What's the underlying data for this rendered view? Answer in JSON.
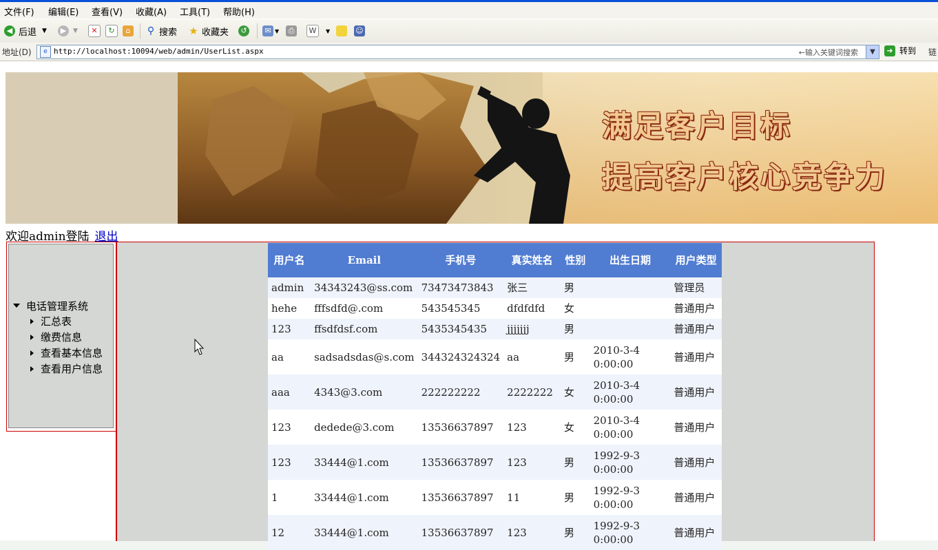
{
  "browser": {
    "menu": [
      "文件(F)",
      "编辑(E)",
      "查看(V)",
      "收藏(A)",
      "工具(T)",
      "帮助(H)"
    ],
    "toolbar": {
      "back_label": "后退",
      "search_label": "搜索",
      "favorites_label": "收藏夹"
    },
    "address_label": "地址(D)",
    "url": "http://localhost:10094/web/admin/UserList.aspx",
    "search_placeholder": "←输入关键词搜索",
    "go_label": "转到",
    "links_label": "链"
  },
  "banner": {
    "slogan_line1": "满足客户目标",
    "slogan_line2": "提高客户核心竞争力"
  },
  "welcome": {
    "text": "欢迎admin登陆",
    "logout": "退出"
  },
  "sidebar": {
    "root": "电话管理系统",
    "items": [
      {
        "label": "汇总表"
      },
      {
        "label": "缴费信息"
      },
      {
        "label": "查看基本信息"
      },
      {
        "label": "查看用户信息"
      }
    ]
  },
  "table": {
    "headers": [
      "用户名",
      "Email",
      "手机号",
      "真实姓名",
      "性别",
      "出生日期",
      "用户类型"
    ],
    "rows": [
      {
        "username": "admin",
        "email": "34343243@ss.com",
        "phone": "73473473843",
        "realname": "张三",
        "gender": "男",
        "birth": "",
        "type": "管理员"
      },
      {
        "username": "hehe",
        "email": "fffsdfd@.com",
        "phone": "543545345",
        "realname": "dfdfdfd",
        "gender": "女",
        "birth": "",
        "type": "普通用户"
      },
      {
        "username": "123",
        "email": "ffsdfdsf.com",
        "phone": "5435345435",
        "realname": "jjjjjjj",
        "gender": "男",
        "birth": "",
        "type": "普通用户"
      },
      {
        "username": "aa",
        "email": "sadsadsdas@s.com",
        "phone": "344324324324",
        "realname": "aa",
        "gender": "男",
        "birth": "2010-3-4 0:00:00",
        "type": "普通用户"
      },
      {
        "username": "aaa",
        "email": "4343@3.com",
        "phone": "222222222",
        "realname": "2222222",
        "gender": "女",
        "birth": "2010-3-4 0:00:00",
        "type": "普通用户"
      },
      {
        "username": "123",
        "email": "dedede@3.com",
        "phone": "13536637897",
        "realname": "123",
        "gender": "女",
        "birth": "2010-3-4 0:00:00",
        "type": "普通用户"
      },
      {
        "username": "123",
        "email": "33444@1.com",
        "phone": "13536637897",
        "realname": "123",
        "gender": "男",
        "birth": "1992-9-3 0:00:00",
        "type": "普通用户"
      },
      {
        "username": "1",
        "email": "33444@1.com",
        "phone": "13536637897",
        "realname": "11",
        "gender": "男",
        "birth": "1992-9-3 0:00:00",
        "type": "普通用户"
      },
      {
        "username": "12",
        "email": "33444@1.com",
        "phone": "13536637897",
        "realname": "123",
        "gender": "男",
        "birth": "1992-9-3 0:00:00",
        "type": "普通用户"
      }
    ]
  },
  "colors": {
    "header_bg": "#507cd1",
    "row_alt_bg": "#eff3fb",
    "frame_border": "#cc0000",
    "panel_bg": "#d4d7d4"
  }
}
